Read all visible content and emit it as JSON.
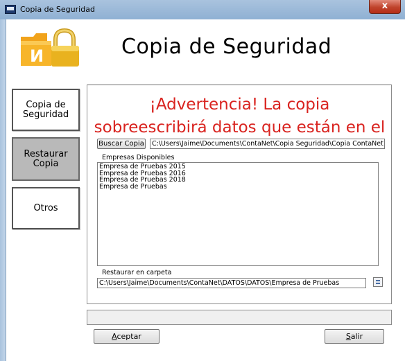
{
  "window": {
    "title": "Copia de Seguridad",
    "close_glyph": "x"
  },
  "header": {
    "title": "Copia de Seguridad",
    "logo_icon": "folder-lock-icon"
  },
  "nav": {
    "items": [
      {
        "label": "Copia de\nSeguridad",
        "state": "normal"
      },
      {
        "label": "Restaurar\nCopia",
        "state": "selected"
      },
      {
        "label": "Otros",
        "state": "normal"
      }
    ]
  },
  "main": {
    "warning": "¡Advertencia! La copia sobreescribirá datos que están en el disco duro.",
    "buscar_copia_label": "Buscar Copia",
    "copy_path": "C:\\Users\\Jaime\\Documents\\ContaNet\\Copia Seguridad\\Copia ContaNet",
    "empresas_label": "Empresas Disponibles",
    "empresas": [
      "Empresa de Pruebas 2015",
      "Empresa de Pruebas 2016",
      "Empresa de Pruebas 2018",
      "Empresa de Pruebas"
    ],
    "restore_label": "Restaurar en carpeta",
    "restore_path": "C:\\Users\\Jaime\\Documents\\ContaNet\\DATOS\\DATOS\\Empresa de Pruebas"
  },
  "footer": {
    "accept_label": "Aceptar",
    "accept_accel": "A",
    "accept_rest": "ceptar",
    "exit_label": "Salir",
    "exit_accel": "S",
    "exit_rest": "alir"
  },
  "colors": {
    "warning": "#d9231f",
    "titlebar": "#a9c3de",
    "selected_nav": "#b9b9b9"
  }
}
